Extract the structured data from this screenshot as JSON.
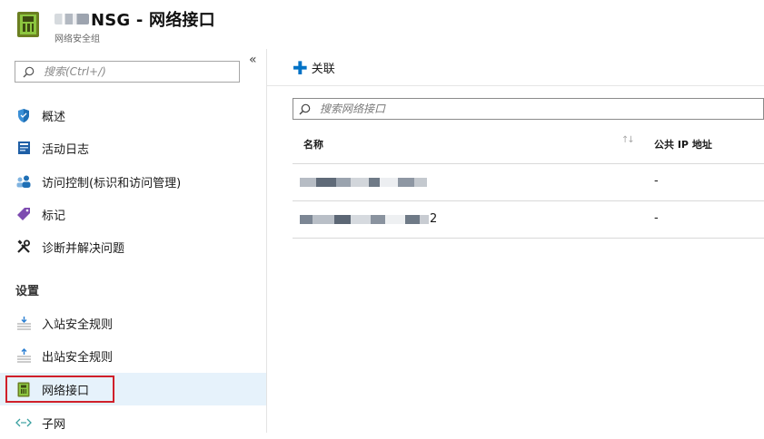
{
  "header": {
    "title": "NSG - 网络接口",
    "subtitle": "网络安全组",
    "icon": "network-interface-icon"
  },
  "sidebar": {
    "collapse_glyph": "«",
    "search": {
      "placeholder": "搜索(Ctrl+/)"
    },
    "items": [
      {
        "label": "概述",
        "icon": "shield-icon"
      },
      {
        "label": "活动日志",
        "icon": "activity-log-icon"
      },
      {
        "label": "访问控制(标识和访问管理)",
        "icon": "access-control-icon"
      },
      {
        "label": "标记",
        "icon": "tag-icon"
      },
      {
        "label": "诊断并解决问题",
        "icon": "wrench-icon"
      }
    ],
    "section_title": "设置",
    "settings_items": [
      {
        "label": "入站安全规则",
        "icon": "inbound-rules-icon"
      },
      {
        "label": "出站安全规则",
        "icon": "outbound-rules-icon"
      },
      {
        "label": "网络接口",
        "icon": "network-interface-icon",
        "selected": true
      },
      {
        "label": "子网",
        "icon": "subnet-icon"
      }
    ]
  },
  "main": {
    "toolbar": {
      "associate_label": "关联"
    },
    "filter": {
      "placeholder": "搜索网络接口"
    },
    "columns": [
      {
        "label": "名称",
        "sortable": true
      },
      {
        "label": "公共 IP 地址"
      }
    ],
    "rows": [
      {
        "name_suffix": "",
        "public_ip": "-"
      },
      {
        "name_suffix": "2",
        "public_ip": "-"
      }
    ]
  },
  "colors": {
    "accent": "#0072c6",
    "selected_bg": "#e6f2fb",
    "highlight_border": "#d0202a"
  }
}
